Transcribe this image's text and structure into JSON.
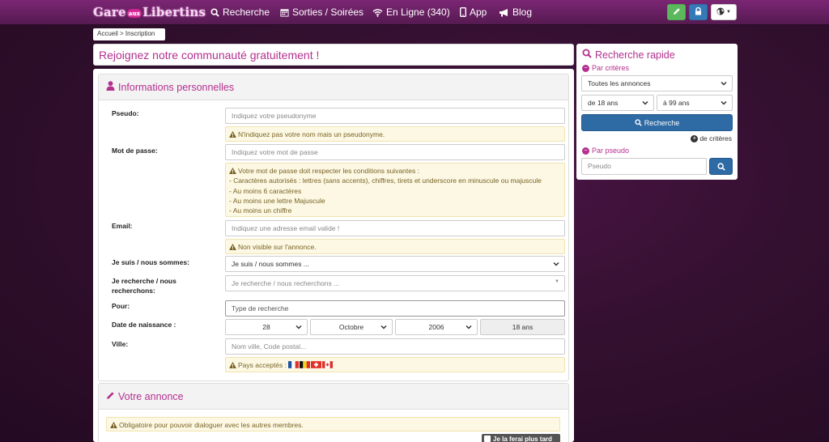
{
  "brand": {
    "logo_part1": "Gare",
    "logo_aux": "aux",
    "logo_part2": "Libertins"
  },
  "nav": {
    "search": "Recherche",
    "outings": "Sorties / Soirées",
    "online": "En Ligne (340)",
    "app": "App",
    "blog": "Blog"
  },
  "breadcrumb": "Accueil > Inscription",
  "page_title": "Rejoignez notre communauté gratuitement !",
  "personal": {
    "heading": "Informations personnelles",
    "pseudo_label": "Pseudo:",
    "pseudo_placeholder": "Indiquez votre pseudonyme",
    "pseudo_hint": "N'indiquez pas votre nom mais un pseudonyme.",
    "password_label": "Mot de passe:",
    "password_placeholder": "Indiquez votre mot de passe",
    "password_rules": [
      "Votre mot de passe doit respecter les conditions suivantes :",
      "- Caractères autorisés : lettres (sans accents), chiffres, tirets et underscore en minuscule ou majuscule",
      "- Au moins 6 caractères",
      "- Au moins une lettre Majuscule",
      "- Au moins un chiffre"
    ],
    "email_label": "Email:",
    "email_placeholder": "Indiquez une adresse email valide !",
    "email_hint": "Non visible sur l'annonce.",
    "iam_label": "Je suis / nous sommes:",
    "iam_value": "Je suis / nous sommes ...",
    "seek_label_1": "Je recherche / nous",
    "seek_label_2": "recherchons:",
    "seek_value": "Je recherche / nous recherchons ...",
    "for_label": "Pour:",
    "for_placeholder": "Type de recherche",
    "dob_label": "Date de naissance :",
    "dob_day": "28",
    "dob_month": "Octobre",
    "dob_year": "2006",
    "dob_age": "18 ans",
    "city_label": "Ville:",
    "city_placeholder": "Nom ville, Code postal...",
    "countries_hint": "Pays acceptés :"
  },
  "ad": {
    "heading": "Votre annonce",
    "notice": "Obligatoire pour pouvoir dialoguer avec les autres membres.",
    "later_button": "Je la ferai plus tard"
  },
  "quick_search": {
    "heading": "Recherche rapide",
    "by_criteria": "Par critères",
    "ads_select": "Toutes les annonces",
    "age_from": "de 18 ans",
    "age_to": "à 99 ans",
    "search_button": "Recherche",
    "more_criteria": "de critères",
    "by_pseudo": "Par pseudo",
    "pseudo_placeholder": "Pseudo"
  },
  "colors": {
    "accent": "#b3308f",
    "nav": "#6a2063",
    "primary": "#2e6aa3",
    "green": "#5cb85c",
    "alert_bg": "#fcf8e3"
  }
}
